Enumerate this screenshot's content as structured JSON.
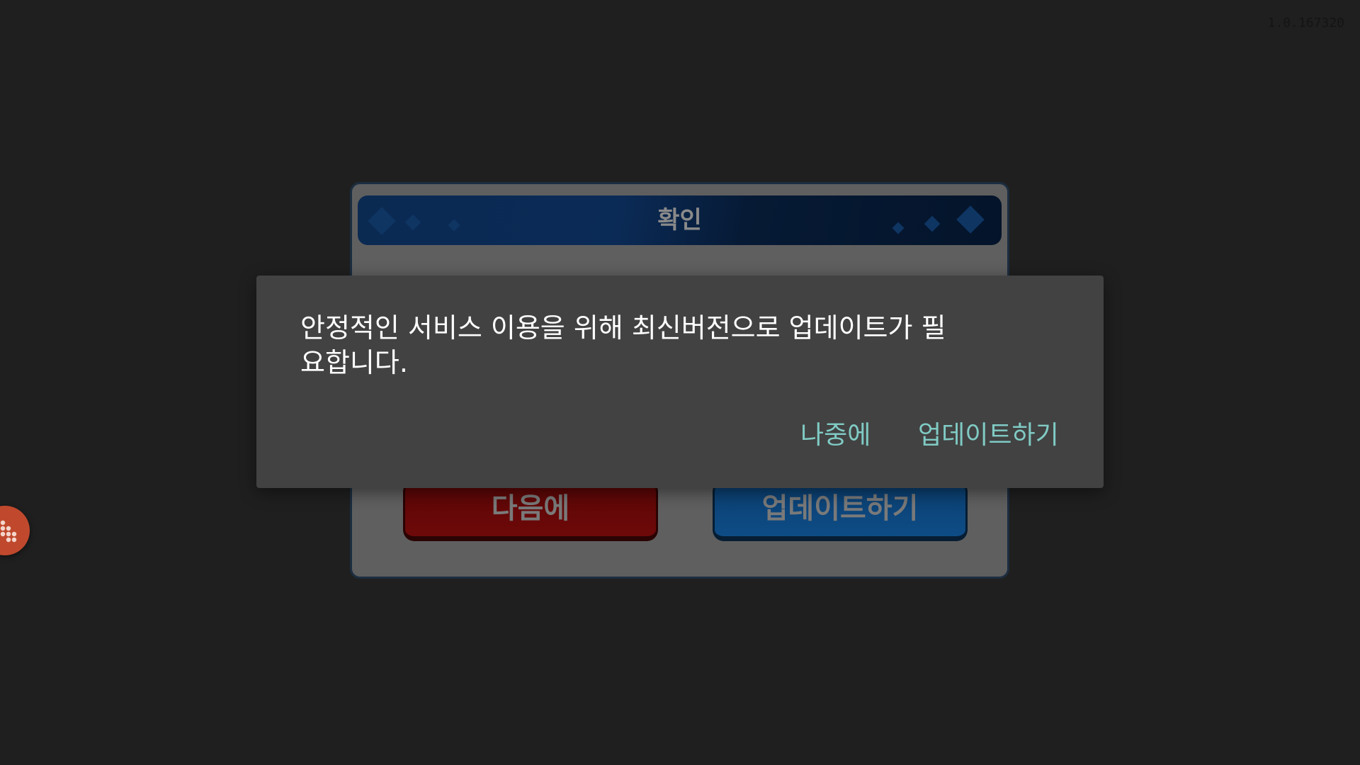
{
  "version_label": "1.0.167320",
  "game_dialog": {
    "title": "확인",
    "later_button": "다음에",
    "update_button": "업데이트하기"
  },
  "alert": {
    "message": "안정적인 서비스 이용을 위해 최신버전으로 업데이트가 필요합니다.",
    "later_button": "나중에",
    "update_button": "업데이트하기"
  },
  "floating_button": {
    "icon": "dots-grid-icon",
    "color": "#c0492d"
  },
  "colors": {
    "alert_background": "#424242",
    "alert_button_text": "#80cbc4",
    "screen_background": "#1f1f1f"
  }
}
